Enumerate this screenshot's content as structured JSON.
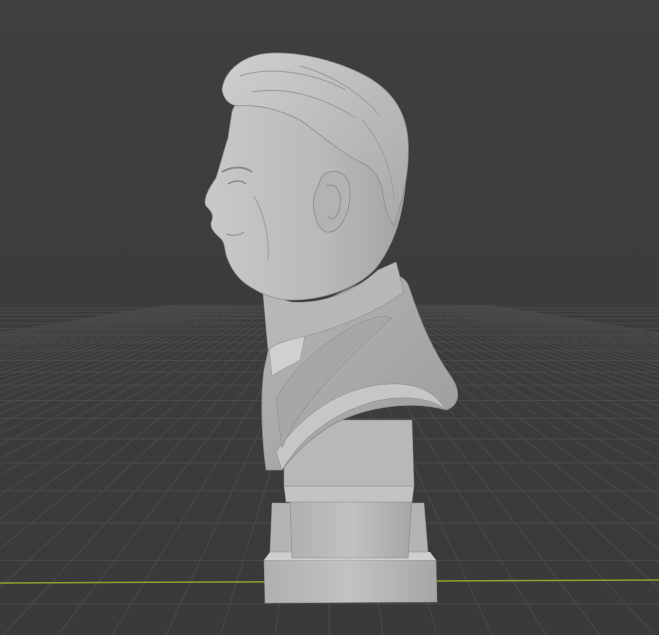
{
  "viewport": {
    "background_color": "#3e3e3e",
    "grid_line_color": "#4a4a4a",
    "x_axis_color": "#8aa42c",
    "model_base_color": "#bdbdbd",
    "model_shadow_color": "#9a9a9a",
    "model_highlight_color": "#d4d4d4"
  },
  "model": {
    "subject": "sculpted-bust-of-man-in-profile"
  }
}
